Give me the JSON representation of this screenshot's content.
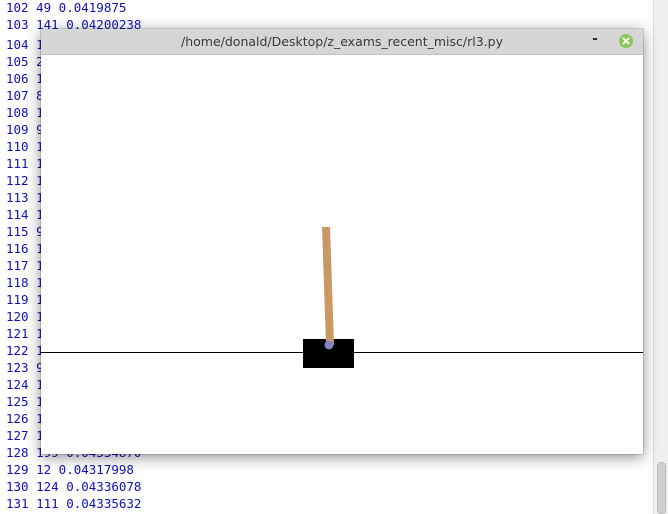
{
  "terminal": {
    "lines": [
      "102 49 0.0419875",
      "103 141 0.04200238",
      "104 1",
      "105 2",
      "106 1",
      "107 8",
      "108 1",
      "109 9",
      "110 1",
      "111 1",
      "112 1",
      "113 1",
      "114 1",
      "115 9",
      "116 1",
      "117 1",
      "118 1",
      "119 1",
      "120 1",
      "121 1",
      "122 1",
      "123 9",
      "124 1",
      "125 1",
      "126 1",
      "127 1",
      "128 199 0.04334870",
      "129 12 0.04317998",
      "130 124 0.04336078",
      "131 111 0.04335632"
    ],
    "text_color": "#1010b8"
  },
  "window": {
    "title": "/home/donald/Desktop/z_exams_recent_misc/rl3.py",
    "minimize_label": "-",
    "minimize_icon": "minimize-icon",
    "close_icon": "close-icon",
    "close_color": "#8fc65c"
  },
  "scene": {
    "name": "cartpole",
    "cart_color": "#000000",
    "pole_color": "#ca9865",
    "axle_color": "#8184cb",
    "track_color": "#000000"
  }
}
